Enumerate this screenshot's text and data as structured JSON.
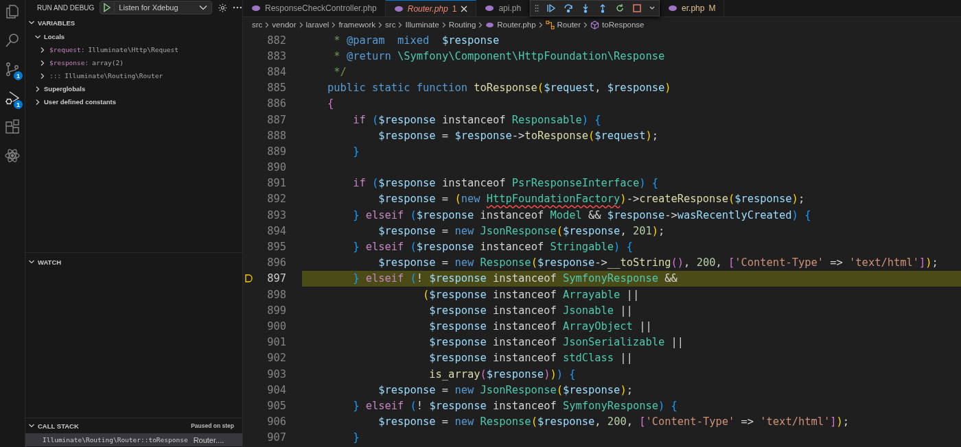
{
  "activity_bar": [
    {
      "kind": "files",
      "selected": false
    },
    {
      "kind": "search",
      "selected": false
    },
    {
      "kind": "source-control",
      "badge": "1",
      "selected": false
    },
    {
      "kind": "run-debug",
      "badge": "1",
      "selected": true
    },
    {
      "kind": "extensions",
      "selected": false
    },
    {
      "kind": "atom",
      "selected": false
    }
  ],
  "sidebar": {
    "title": "RUN AND DEBUG",
    "configuration": "Listen for Xdebug",
    "variables": {
      "title": "VARIABLES",
      "expanded": true,
      "scopes": [
        {
          "label": "Locals",
          "expanded": true,
          "children": [
            {
              "name": "$request:",
              "value": "Illuminate\\Http\\Request",
              "expanded": false
            },
            {
              "name": "$response:",
              "value": "array(2)",
              "expanded": false
            },
            {
              "name": ":::",
              "value": "Illuminate\\Routing\\Router",
              "expanded": false
            }
          ]
        },
        {
          "label": "Superglobals",
          "expanded": false
        },
        {
          "label": "User defined constants",
          "expanded": false
        }
      ]
    },
    "watch": {
      "title": "WATCH",
      "expanded": true
    },
    "call_stack": {
      "title": "CALL STACK",
      "expanded": true,
      "status": "Paused on step",
      "frames": [
        {
          "name": "Illuminate\\Routing\\Router::toResponse",
          "file": "Router....",
          "selected": true
        }
      ]
    }
  },
  "editor": {
    "tabs": [
      {
        "label": "ResponseCheckController.php",
        "kind": "plain",
        "preview": false,
        "selected": false
      },
      {
        "label": "Router.php",
        "badge": "1",
        "kind": "error",
        "preview": true,
        "selected": true
      },
      {
        "label": "api.ph",
        "kind": "plain",
        "preview": false,
        "selected": false
      },
      {
        "label": "er.php",
        "badge": "M",
        "kind": "modified",
        "preview": false,
        "selected": false
      }
    ],
    "breadcrumbs": [
      {
        "label": "src",
        "kind": "folder"
      },
      {
        "label": "vendor",
        "kind": "folder"
      },
      {
        "label": "laravel",
        "kind": "folder"
      },
      {
        "label": "framework",
        "kind": "folder"
      },
      {
        "label": "src",
        "kind": "folder"
      },
      {
        "label": "Illuminate",
        "kind": "folder"
      },
      {
        "label": "Routing",
        "kind": "folder"
      },
      {
        "label": "Router.php",
        "kind": "file"
      },
      {
        "label": "Router",
        "kind": "class"
      },
      {
        "label": "toResponse",
        "kind": "method"
      }
    ],
    "lines": [
      {
        "number": "882",
        "current": false,
        "tokens": [
          {
            "t": "     * ",
            "kind": "cmt"
          },
          {
            "t": "@param",
            "kind": "kw"
          },
          {
            "t": "  mixed",
            "kind": "kw"
          },
          {
            "t": "  $response",
            "kind": "var"
          }
        ]
      },
      {
        "number": "883",
        "current": false,
        "tokens": [
          {
            "t": "     * ",
            "kind": "cmt"
          },
          {
            "t": "@return",
            "kind": "kw"
          },
          {
            "t": " \\Symfony\\Component\\HttpFoundation\\Response",
            "kind": "cls"
          }
        ]
      },
      {
        "number": "884",
        "current": false,
        "tokens": [
          {
            "t": "     */",
            "kind": "cmt"
          }
        ]
      },
      {
        "number": "885",
        "current": false,
        "tokens": [
          {
            "t": "    public static function",
            "kind": "kw"
          },
          {
            "t": " toResponse",
            "kind": "fn"
          },
          {
            "t": "(",
            "kind": "b1"
          },
          {
            "t": "$request",
            "kind": "var"
          },
          {
            "t": ", ",
            "kind": "p"
          },
          {
            "t": "$response",
            "kind": "var"
          },
          {
            "t": ")",
            "kind": "b1"
          }
        ]
      },
      {
        "number": "886",
        "current": false,
        "tokens": [
          {
            "t": "    {",
            "kind": "b2"
          }
        ]
      },
      {
        "number": "887",
        "current": false,
        "tokens": [
          {
            "t": "        if",
            "kind": "ctl"
          },
          {
            "t": " (",
            "kind": "b3"
          },
          {
            "t": "$response",
            "kind": "var"
          },
          {
            "t": " instanceof ",
            "kind": "p"
          },
          {
            "t": "Responsable",
            "kind": "cls"
          },
          {
            "t": ")",
            "kind": "b3"
          },
          {
            "t": " {",
            "kind": "b3"
          }
        ]
      },
      {
        "number": "888",
        "current": false,
        "tokens": [
          {
            "t": "            $response",
            "kind": "var"
          },
          {
            "t": " = ",
            "kind": "p"
          },
          {
            "t": "$response",
            "kind": "var"
          },
          {
            "t": "->",
            "kind": "p"
          },
          {
            "t": "toResponse",
            "kind": "fn"
          },
          {
            "t": "(",
            "kind": "b1"
          },
          {
            "t": "$request",
            "kind": "var"
          },
          {
            "t": ")",
            "kind": "b1"
          },
          {
            "t": ";",
            "kind": "p"
          }
        ]
      },
      {
        "number": "889",
        "current": false,
        "tokens": [
          {
            "t": "        }",
            "kind": "b3"
          }
        ]
      },
      {
        "number": "890",
        "current": false
      },
      {
        "number": "891",
        "current": false,
        "tokens": [
          {
            "t": "        if",
            "kind": "ctl"
          },
          {
            "t": " (",
            "kind": "b3"
          },
          {
            "t": "$response",
            "kind": "var"
          },
          {
            "t": " instanceof ",
            "kind": "p"
          },
          {
            "t": "PsrResponseInterface",
            "kind": "cls"
          },
          {
            "t": ")",
            "kind": "b3"
          },
          {
            "t": " {",
            "kind": "b3"
          }
        ]
      },
      {
        "number": "892",
        "current": false,
        "tokens": [
          {
            "t": "            $response",
            "kind": "var"
          },
          {
            "t": " = ",
            "kind": "p"
          },
          {
            "t": "(",
            "kind": "b1"
          },
          {
            "t": "new ",
            "kind": "kw"
          },
          {
            "t": "HttpFoundationFactory",
            "kind": "cls-err"
          },
          {
            "t": ")",
            "kind": "b1"
          },
          {
            "t": "->",
            "kind": "p"
          },
          {
            "t": "createResponse",
            "kind": "fn"
          },
          {
            "t": "(",
            "kind": "b1"
          },
          {
            "t": "$response",
            "kind": "var"
          },
          {
            "t": ")",
            "kind": "b1"
          },
          {
            "t": ";",
            "kind": "p"
          }
        ]
      },
      {
        "number": "893",
        "current": false,
        "tokens": [
          {
            "t": "        }",
            "kind": "b3"
          },
          {
            "t": " elseif",
            "kind": "ctl"
          },
          {
            "t": " (",
            "kind": "b3"
          },
          {
            "t": "$response",
            "kind": "var"
          },
          {
            "t": " instanceof ",
            "kind": "p"
          },
          {
            "t": "Model",
            "kind": "cls"
          },
          {
            "t": " && ",
            "kind": "p"
          },
          {
            "t": "$response",
            "kind": "var"
          },
          {
            "t": "->",
            "kind": "p"
          },
          {
            "t": "wasRecentlyCreated",
            "kind": "var"
          },
          {
            "t": ")",
            "kind": "b3"
          },
          {
            "t": " {",
            "kind": "b3"
          }
        ]
      },
      {
        "number": "894",
        "current": false,
        "tokens": [
          {
            "t": "            $response",
            "kind": "var"
          },
          {
            "t": " = ",
            "kind": "p"
          },
          {
            "t": "new",
            "kind": "kw"
          },
          {
            "t": " JsonResponse",
            "kind": "cls"
          },
          {
            "t": "(",
            "kind": "b1"
          },
          {
            "t": "$response",
            "kind": "var"
          },
          {
            "t": ", ",
            "kind": "p"
          },
          {
            "t": "201",
            "kind": "num"
          },
          {
            "t": ")",
            "kind": "b1"
          },
          {
            "t": ";",
            "kind": "p"
          }
        ]
      },
      {
        "number": "895",
        "current": false,
        "tokens": [
          {
            "t": "        }",
            "kind": "b3"
          },
          {
            "t": " elseif",
            "kind": "ctl"
          },
          {
            "t": " (",
            "kind": "b3"
          },
          {
            "t": "$response",
            "kind": "var"
          },
          {
            "t": " instanceof ",
            "kind": "p"
          },
          {
            "t": "Stringable",
            "kind": "cls"
          },
          {
            "t": ")",
            "kind": "b3"
          },
          {
            "t": " {",
            "kind": "b3"
          }
        ]
      },
      {
        "number": "896",
        "current": false,
        "tokens": [
          {
            "t": "            $response",
            "kind": "var"
          },
          {
            "t": " = ",
            "kind": "p"
          },
          {
            "t": "new",
            "kind": "kw"
          },
          {
            "t": " Response",
            "kind": "cls"
          },
          {
            "t": "(",
            "kind": "b1"
          },
          {
            "t": "$response",
            "kind": "var"
          },
          {
            "t": "->",
            "kind": "p"
          },
          {
            "t": "__toString",
            "kind": "fn"
          },
          {
            "t": "()",
            "kind": "b2"
          },
          {
            "t": ", ",
            "kind": "p"
          },
          {
            "t": "200",
            "kind": "num"
          },
          {
            "t": ", ",
            "kind": "p"
          },
          {
            "t": "[",
            "kind": "b2"
          },
          {
            "t": "'Content-Type'",
            "kind": "str"
          },
          {
            "t": " => ",
            "kind": "p"
          },
          {
            "t": "'text/html'",
            "kind": "str"
          },
          {
            "t": "]",
            "kind": "b2"
          },
          {
            "t": ")",
            "kind": "b1"
          },
          {
            "t": ";",
            "kind": "p"
          }
        ]
      },
      {
        "number": "897",
        "current": true,
        "tokens": [
          {
            "t": "        }",
            "kind": "b3"
          },
          {
            "t": " elseif",
            "kind": "ctl"
          },
          {
            "t": " (",
            "kind": "b3"
          },
          {
            "t": "! ",
            "kind": "p"
          },
          {
            "t": "$response",
            "kind": "var"
          },
          {
            "t": " instanceof ",
            "kind": "p"
          },
          {
            "t": "SymfonyResponse",
            "kind": "cls"
          },
          {
            "t": " &&",
            "kind": "p"
          }
        ]
      },
      {
        "number": "898",
        "current": false,
        "tokens": [
          {
            "t": "                   (",
            "kind": "b1"
          },
          {
            "t": "$response",
            "kind": "var"
          },
          {
            "t": " instanceof ",
            "kind": "p"
          },
          {
            "t": "Arrayable",
            "kind": "cls"
          },
          {
            "t": " ||",
            "kind": "p"
          }
        ]
      },
      {
        "number": "899",
        "current": false,
        "tokens": [
          {
            "t": "                    $response",
            "kind": "var"
          },
          {
            "t": " instanceof ",
            "kind": "p"
          },
          {
            "t": "Jsonable",
            "kind": "cls"
          },
          {
            "t": " ||",
            "kind": "p"
          }
        ]
      },
      {
        "number": "900",
        "current": false,
        "tokens": [
          {
            "t": "                    $response",
            "kind": "var"
          },
          {
            "t": " instanceof ",
            "kind": "p"
          },
          {
            "t": "ArrayObject",
            "kind": "cls"
          },
          {
            "t": " ||",
            "kind": "p"
          }
        ]
      },
      {
        "number": "901",
        "current": false,
        "tokens": [
          {
            "t": "                    $response",
            "kind": "var"
          },
          {
            "t": " instanceof ",
            "kind": "p"
          },
          {
            "t": "JsonSerializable",
            "kind": "cls"
          },
          {
            "t": " ||",
            "kind": "p"
          }
        ]
      },
      {
        "number": "902",
        "current": false,
        "tokens": [
          {
            "t": "                    $response",
            "kind": "var"
          },
          {
            "t": " instanceof ",
            "kind": "p"
          },
          {
            "t": "stdClass",
            "kind": "cls"
          },
          {
            "t": " ||",
            "kind": "p"
          }
        ]
      },
      {
        "number": "903",
        "current": false,
        "tokens": [
          {
            "t": "                    is_array",
            "kind": "fn"
          },
          {
            "t": "(",
            "kind": "b2"
          },
          {
            "t": "$response",
            "kind": "var"
          },
          {
            "t": ")",
            "kind": "b2"
          },
          {
            "t": ")",
            "kind": "b1"
          },
          {
            "t": ")",
            "kind": "b3"
          },
          {
            "t": " {",
            "kind": "b3"
          }
        ]
      },
      {
        "number": "904",
        "current": false,
        "tokens": [
          {
            "t": "            $response",
            "kind": "var"
          },
          {
            "t": " = ",
            "kind": "p"
          },
          {
            "t": "new",
            "kind": "kw"
          },
          {
            "t": " JsonResponse",
            "kind": "cls"
          },
          {
            "t": "(",
            "kind": "b1"
          },
          {
            "t": "$response",
            "kind": "var"
          },
          {
            "t": ")",
            "kind": "b1"
          },
          {
            "t": ";",
            "kind": "p"
          }
        ]
      },
      {
        "number": "905",
        "current": false,
        "tokens": [
          {
            "t": "        }",
            "kind": "b3"
          },
          {
            "t": " elseif",
            "kind": "ctl"
          },
          {
            "t": " (",
            "kind": "b3"
          },
          {
            "t": "! ",
            "kind": "p"
          },
          {
            "t": "$response",
            "kind": "var"
          },
          {
            "t": " instanceof ",
            "kind": "p"
          },
          {
            "t": "SymfonyResponse",
            "kind": "cls"
          },
          {
            "t": ")",
            "kind": "b3"
          },
          {
            "t": " {",
            "kind": "b3"
          }
        ]
      },
      {
        "number": "906",
        "current": false,
        "tokens": [
          {
            "t": "            $response",
            "kind": "var"
          },
          {
            "t": " = ",
            "kind": "p"
          },
          {
            "t": "new",
            "kind": "kw"
          },
          {
            "t": " Response",
            "kind": "cls"
          },
          {
            "t": "(",
            "kind": "b1"
          },
          {
            "t": "$response",
            "kind": "var"
          },
          {
            "t": ", ",
            "kind": "p"
          },
          {
            "t": "200",
            "kind": "num"
          },
          {
            "t": ", ",
            "kind": "p"
          },
          {
            "t": "[",
            "kind": "b2"
          },
          {
            "t": "'Content-Type'",
            "kind": "str"
          },
          {
            "t": " => ",
            "kind": "p"
          },
          {
            "t": "'text/html'",
            "kind": "str"
          },
          {
            "t": "]",
            "kind": "b2"
          },
          {
            "t": ")",
            "kind": "b1"
          },
          {
            "t": ";",
            "kind": "p"
          }
        ]
      },
      {
        "number": "907",
        "current": false,
        "tokens": [
          {
            "t": "        }",
            "kind": "b3"
          }
        ]
      }
    ]
  }
}
